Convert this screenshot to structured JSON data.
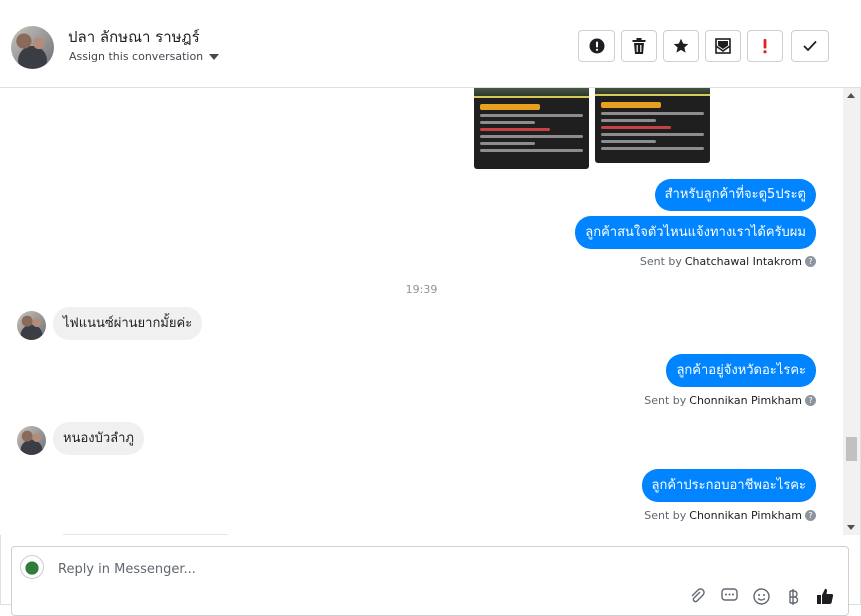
{
  "header": {
    "contact_name": "ปลา ลักษณา ราษฎร์",
    "assign_label": "Assign this conversation",
    "actions": [
      {
        "name": "mark-spam-button",
        "icon": "alert-circle-icon"
      },
      {
        "name": "delete-button",
        "icon": "trash-icon"
      },
      {
        "name": "star-button",
        "icon": "star-icon"
      },
      {
        "name": "mark-unread-button",
        "icon": "envelope-icon"
      },
      {
        "name": "follow-up-button",
        "icon": "exclamation-icon"
      },
      {
        "name": "mark-done-button",
        "icon": "checkmark-icon"
      }
    ]
  },
  "thread": {
    "messages": [
      {
        "direction": "out",
        "text": "สำหรับลูกค้าที่จะดู5ประตู"
      },
      {
        "direction": "out",
        "text": "ลูกค้าสนใจตัวไหนแจ้งทางเราได้ครับผม"
      },
      {
        "sent_by_prefix": "Sent by",
        "sent_by_name": "Chatchawal Intakrom"
      },
      {
        "timestamp": "19:39"
      },
      {
        "direction": "in",
        "text": "ไฟแนนซ์ผ่านยากมั้ยค่ะ"
      },
      {
        "direction": "out",
        "text": "ลูกค้าอยู่จังหวัดอะไรคะ"
      },
      {
        "sent_by_prefix": "Sent by",
        "sent_by_name": "Chonnikan Pimkham"
      },
      {
        "direction": "in",
        "text": "หนองบัวลำภู"
      },
      {
        "direction": "out",
        "text": "ลูกค้าประกอบอาชีพอะไรคะ"
      },
      {
        "sent_by_prefix": "Sent by",
        "sent_by_name": "Chonnikan Pimkham"
      }
    ]
  },
  "composer": {
    "placeholder": "Reply in Messenger..."
  },
  "colors": {
    "outgoing_bubble": "#0084ff",
    "incoming_bubble": "#f1f0f0",
    "follow_up_red": "#e02020"
  }
}
